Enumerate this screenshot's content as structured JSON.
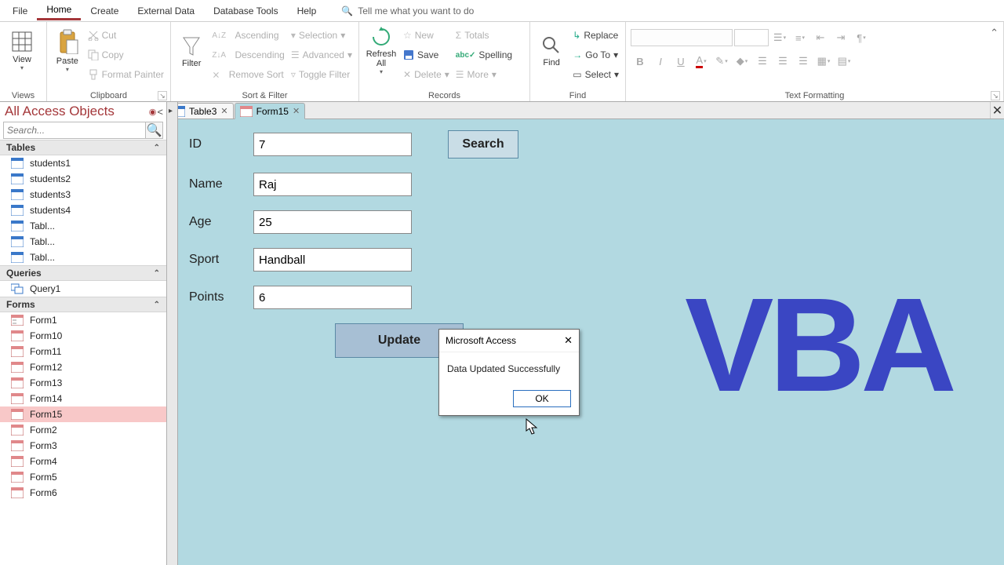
{
  "menu": {
    "items": [
      "File",
      "Home",
      "Create",
      "External Data",
      "Database Tools",
      "Help"
    ],
    "active": "Home",
    "tellme": "Tell me what you want to do"
  },
  "ribbon": {
    "views": {
      "label": "Views",
      "btn": "View"
    },
    "clipboard": {
      "label": "Clipboard",
      "paste": "Paste",
      "cut": "Cut",
      "copy": "Copy",
      "fmt": "Format Painter"
    },
    "sortfilter": {
      "label": "Sort & Filter",
      "filter": "Filter",
      "asc": "Ascending",
      "desc": "Descending",
      "remove": "Remove Sort",
      "sel": "Selection",
      "adv": "Advanced",
      "tog": "Toggle Filter"
    },
    "records": {
      "label": "Records",
      "refresh": "Refresh\nAll",
      "new": "New",
      "save": "Save",
      "delete": "Delete",
      "totals": "Totals",
      "spell": "Spelling",
      "more": "More"
    },
    "find": {
      "label": "Find",
      "find": "Find",
      "replace": "Replace",
      "goto": "Go To",
      "select": "Select"
    },
    "text": {
      "label": "Text Formatting"
    }
  },
  "nav": {
    "title": "All Access Objects",
    "search_placeholder": "Search...",
    "categories": [
      {
        "name": "Tables",
        "items": [
          "students1",
          "students2",
          "students3",
          "students4",
          "Tabl...",
          "Tabl...",
          "Tabl..."
        ]
      },
      {
        "name": "Queries",
        "items": [
          "Query1"
        ]
      },
      {
        "name": "Forms",
        "items": [
          "Form1",
          "Form10",
          "Form11",
          "Form12",
          "Form13",
          "Form14",
          "Form15",
          "Form2",
          "Form3",
          "Form4",
          "Form5",
          "Form6"
        ],
        "selected": "Form15"
      }
    ]
  },
  "tabs": [
    {
      "label": "Table3",
      "icon": "table",
      "active": false
    },
    {
      "label": "Form15",
      "icon": "form",
      "active": true
    }
  ],
  "form": {
    "fields": [
      {
        "label": "ID",
        "value": "7"
      },
      {
        "label": "Name",
        "value": "Raj"
      },
      {
        "label": "Age",
        "value": "25"
      },
      {
        "label": "Sport",
        "value": "Handball"
      },
      {
        "label": "Points",
        "value": "6"
      }
    ],
    "search_btn": "Search",
    "update_btn": "Update"
  },
  "watermark": "VBA",
  "dialog": {
    "title": "Microsoft Access",
    "message": "Data Updated Successfully",
    "ok": "OK"
  }
}
